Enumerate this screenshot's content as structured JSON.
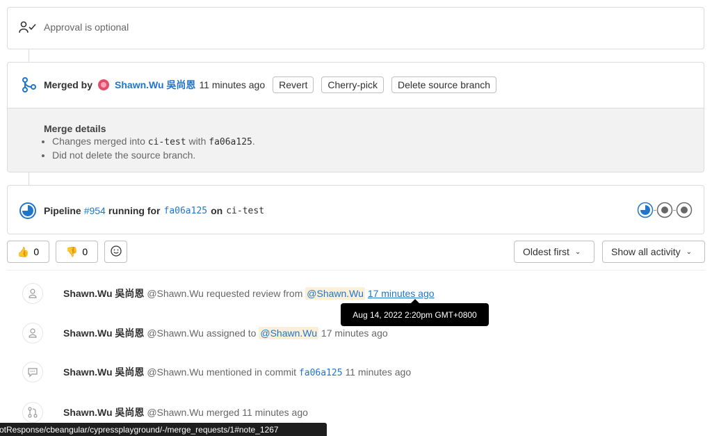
{
  "approval": {
    "text": "Approval is optional"
  },
  "merge": {
    "merged_by_label": "Merged by",
    "user": "Shawn.Wu 吳尚恩",
    "time": "11 minutes ago",
    "buttons": [
      "Revert",
      "Cherry-pick",
      "Delete source branch"
    ],
    "details_title": "Merge details",
    "detail1_pre": "Changes merged into",
    "detail1_branch": "ci-test",
    "detail1_mid": "with",
    "detail1_commit": "fa06a125",
    "detail1_post": ".",
    "detail2": "Did not delete the source branch."
  },
  "pipeline": {
    "label": "Pipeline",
    "id": "#954",
    "running_for": "running for",
    "commit": "fa06a125",
    "on": "on",
    "branch": "ci-test"
  },
  "awards": {
    "thumbsup": "0",
    "thumbsdown": "0"
  },
  "sort": {
    "order_label": "Oldest first",
    "filter_label": "Show all activity"
  },
  "activities": [
    {
      "author": "Shawn.Wu 吳尚恩",
      "handle": "@Shawn.Wu",
      "action": "requested review from",
      "mention": "@Shawn.Wu",
      "time": "17 minutes ago"
    },
    {
      "author": "Shawn.Wu 吳尚恩",
      "handle": "@Shawn.Wu",
      "action": "assigned to",
      "mention": "@Shawn.Wu",
      "time": "17 minutes ago"
    },
    {
      "author": "Shawn.Wu 吳尚恩",
      "handle": "@Shawn.Wu",
      "action": "mentioned in commit",
      "commit": "fa06a125",
      "time": "11 minutes ago"
    },
    {
      "author": "Shawn.Wu 吳尚恩",
      "handle": "@Shawn.Wu",
      "action": "merged",
      "time": "11 minutes ago"
    }
  ],
  "tooltip": {
    "text": "Aug 14, 2022 2:20pm GMT+0800"
  },
  "status_bar": {
    "url": "BotResponse/cbeangular/cypressplayground/-/merge_requests/1#note_1267"
  },
  "colors": {
    "link": "#1f75cb",
    "mention_bg": "#fbefd8",
    "avatar": "#e44d6a"
  }
}
